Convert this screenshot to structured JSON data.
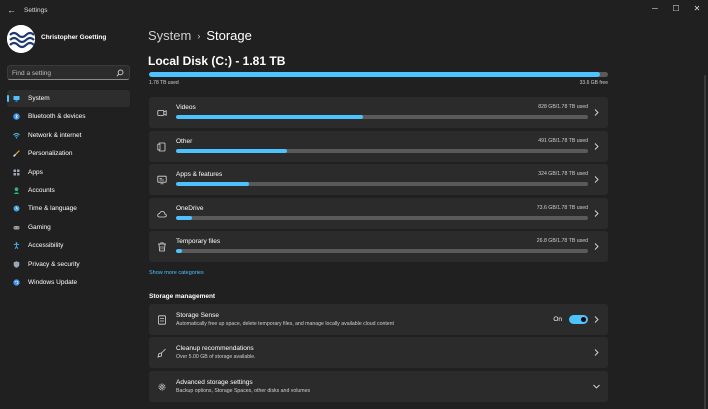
{
  "window": {
    "title": "Settings",
    "controls": {
      "minimize": "─",
      "maximize": "☐",
      "close": "✕"
    }
  },
  "user": {
    "name": "Christopher Goetting"
  },
  "search": {
    "placeholder": "Find a setting"
  },
  "nav": {
    "items": [
      {
        "label": "System",
        "icon": "monitor-icon",
        "color": "#4cc2ff",
        "active": true
      },
      {
        "label": "Bluetooth & devices",
        "icon": "bluetooth-icon",
        "color": "#3a8ee6"
      },
      {
        "label": "Network & internet",
        "icon": "wifi-icon",
        "color": "#4cc2ff"
      },
      {
        "label": "Personalization",
        "icon": "brush-icon",
        "color": "#e8a33d"
      },
      {
        "label": "Apps",
        "icon": "apps-icon",
        "color": "#9aa6b2"
      },
      {
        "label": "Accounts",
        "icon": "person-icon",
        "color": "#2bb67a"
      },
      {
        "label": "Time & language",
        "icon": "globe-clock-icon",
        "color": "#4aa3df"
      },
      {
        "label": "Gaming",
        "icon": "gamepad-icon",
        "color": "#9aa6b2"
      },
      {
        "label": "Accessibility",
        "icon": "accessibility-icon",
        "color": "#4cc2ff"
      },
      {
        "label": "Privacy & security",
        "icon": "shield-icon",
        "color": "#9aa6b2"
      },
      {
        "label": "Windows Update",
        "icon": "update-icon",
        "color": "#3a8ee6"
      }
    ]
  },
  "breadcrumb": {
    "parent": "System",
    "separator": "›",
    "current": "Storage"
  },
  "disk": {
    "title": "Local Disk (C:) - 1.81 TB",
    "used_label": "1.78 TB used",
    "free_label": "33.6 GB free",
    "used_fraction": 0.982
  },
  "categories": [
    {
      "name": "Videos",
      "size": "828 GB/1.78 TB used",
      "fraction": 0.454,
      "icon": "video-icon"
    },
    {
      "name": "Other",
      "size": "491 GB/1.78 TB used",
      "fraction": 0.27,
      "icon": "document-icon"
    },
    {
      "name": "Apps & features",
      "size": "324 GB/1.78 TB used",
      "fraction": 0.178,
      "icon": "apps-features-icon"
    },
    {
      "name": "OneDrive",
      "size": "73.6 GB/1.78 TB used",
      "fraction": 0.04,
      "icon": "cloud-icon"
    },
    {
      "name": "Temporary files",
      "size": "26.8 GB/1.78 TB used",
      "fraction": 0.015,
      "icon": "trash-icon"
    }
  ],
  "show_more": "Show more categories",
  "storage_management": {
    "heading": "Storage management",
    "storage_sense": {
      "title": "Storage Sense",
      "description": "Automatically free up space, delete temporary files, and manage locally available cloud content",
      "toggle_label": "On",
      "enabled": true
    },
    "cleanup": {
      "title": "Cleanup recommendations",
      "description": "Over 5.00 GB of storage available."
    },
    "advanced": {
      "title": "Advanced storage settings",
      "description": "Backup options, Storage Spaces, other disks and volumes"
    }
  },
  "colors": {
    "accent": "#4cc2ff",
    "background": "#202020",
    "card": "#2b2b2b",
    "bar_track": "#5a5a5a"
  }
}
